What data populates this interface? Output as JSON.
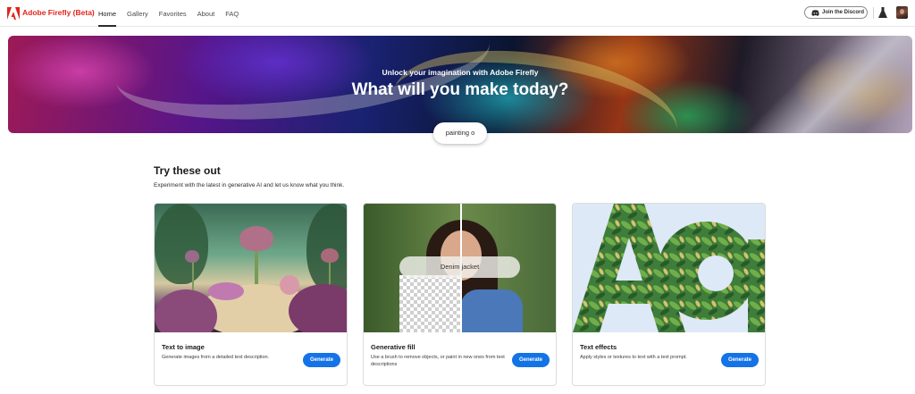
{
  "brand": {
    "name": "Adobe Firefly (Beta)"
  },
  "nav": {
    "links": [
      {
        "label": "Home",
        "active": true
      },
      {
        "label": "Gallery",
        "active": false
      },
      {
        "label": "Favorites",
        "active": false
      },
      {
        "label": "About",
        "active": false
      },
      {
        "label": "FAQ",
        "active": false
      }
    ],
    "discord_label": "Join the Discord"
  },
  "hero": {
    "subtitle": "Unlock your imagination with Adobe Firefly",
    "title": "What will you make today?",
    "prompt_pill": "painting o"
  },
  "section": {
    "title": "Try these out",
    "description": "Experiment with the latest in generative AI and let us know what you think."
  },
  "cards": [
    {
      "title": "Text to image",
      "description": "Generate images from a detailed text description.",
      "button": "Generate"
    },
    {
      "title": "Generative fill",
      "description": "Use a brush to remove objects, or paint in new ones from text descriptions",
      "button": "Generate",
      "overlay_text": "Denim jacket"
    },
    {
      "title": "Text effects",
      "description": "Apply styles or textures to text with a text prompt.",
      "button": "Generate"
    }
  ],
  "colors": {
    "brand_red": "#e1251b",
    "accent_blue": "#1473e6"
  }
}
